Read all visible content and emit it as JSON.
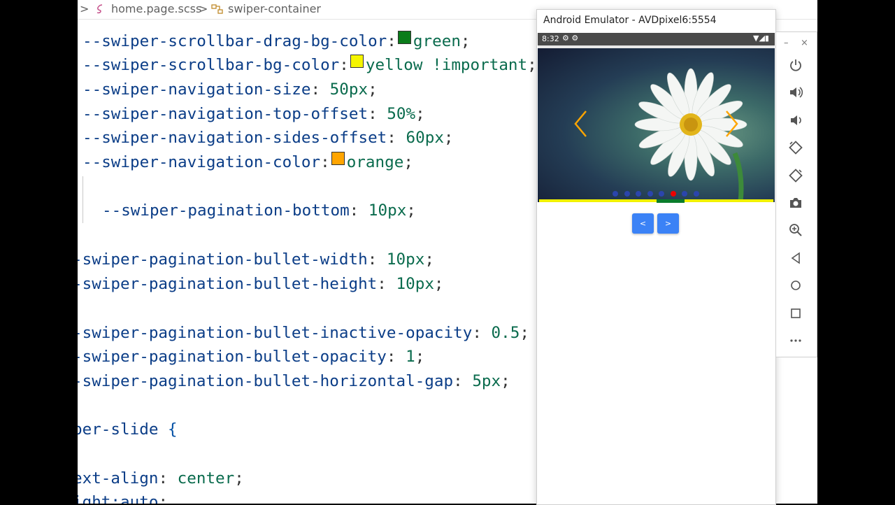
{
  "editor": {
    "breadcrumb": {
      "chevron_1": ">",
      "file": "home.page.scss",
      "chevron_2": ">",
      "symbol": "swiper-container"
    },
    "lines": [
      {
        "prop": "--swiper-scrollbar-drag-bg-color",
        "colon": ":",
        "swatch": "#0a7c1a",
        "value": "green",
        "end": ";"
      },
      {
        "prop": "--swiper-scrollbar-bg-color",
        "colon": ":",
        "swatch": "#f5f500",
        "value": "yellow !important",
        "end": ";"
      },
      {
        "prop": "--swiper-navigation-size",
        "colon": ":",
        "value": " 50px",
        "end": ";"
      },
      {
        "prop": "--swiper-navigation-top-offset",
        "colon": ":",
        "value": " 50%",
        "end": ";"
      },
      {
        "prop": "--swiper-navigation-sides-offset",
        "colon": ":",
        "value": " 60px",
        "end": ";"
      },
      {
        "prop": "--swiper-navigation-color",
        "colon": ":",
        "swatch": "#ffa500",
        "value": "orange",
        "end": ";"
      },
      {
        "prop": "--swiper-pagination-bottom",
        "colon": ":",
        "value": " 10px",
        "end": ";"
      },
      {
        "prop": "-swiper-pagination-bullet-width",
        "colon": ":",
        "value": " 10px",
        "end": ";"
      },
      {
        "prop": "-swiper-pagination-bullet-height",
        "colon": ":",
        "value": " 10px",
        "end": ";"
      },
      {
        "prop": "-swiper-pagination-bullet-inactive-opacity",
        "colon": ":",
        "value": " 0.5",
        "end": ";"
      },
      {
        "prop": "-swiper-pagination-bullet-opacity",
        "colon": ":",
        "value": " 1",
        "end": ";"
      },
      {
        "prop": "-swiper-pagination-bullet-horizontal-gap",
        "colon": ":",
        "value": " 5px",
        "end": ";"
      },
      {
        "selector": "per-slide",
        "brace": " {"
      },
      {
        "prop": "ext-align",
        "colon": ":",
        "value": " center",
        "end": ";"
      },
      {
        "prop": "ight:auto",
        "colon": ";",
        "value": "",
        "end": ""
      }
    ]
  },
  "emulator": {
    "title": "Android Emulator - AVDpixel6:5554",
    "status_time": "8:32",
    "status_icons": "⚙ ⚙",
    "status_right": "▼◢▮",
    "navigation_color": "#ffa500",
    "bullet_count": 8,
    "active_bullet": 5,
    "prev_label": "<",
    "next_label": ">",
    "window_minimize": "–",
    "window_close": "×"
  },
  "toolbar": {
    "tools": [
      "power-icon",
      "volume-up-icon",
      "volume-down-icon",
      "rotate-left-icon",
      "rotate-right-icon",
      "camera-icon",
      "zoom-icon",
      "back-icon",
      "home-icon",
      "overview-icon",
      "more-icon"
    ]
  }
}
